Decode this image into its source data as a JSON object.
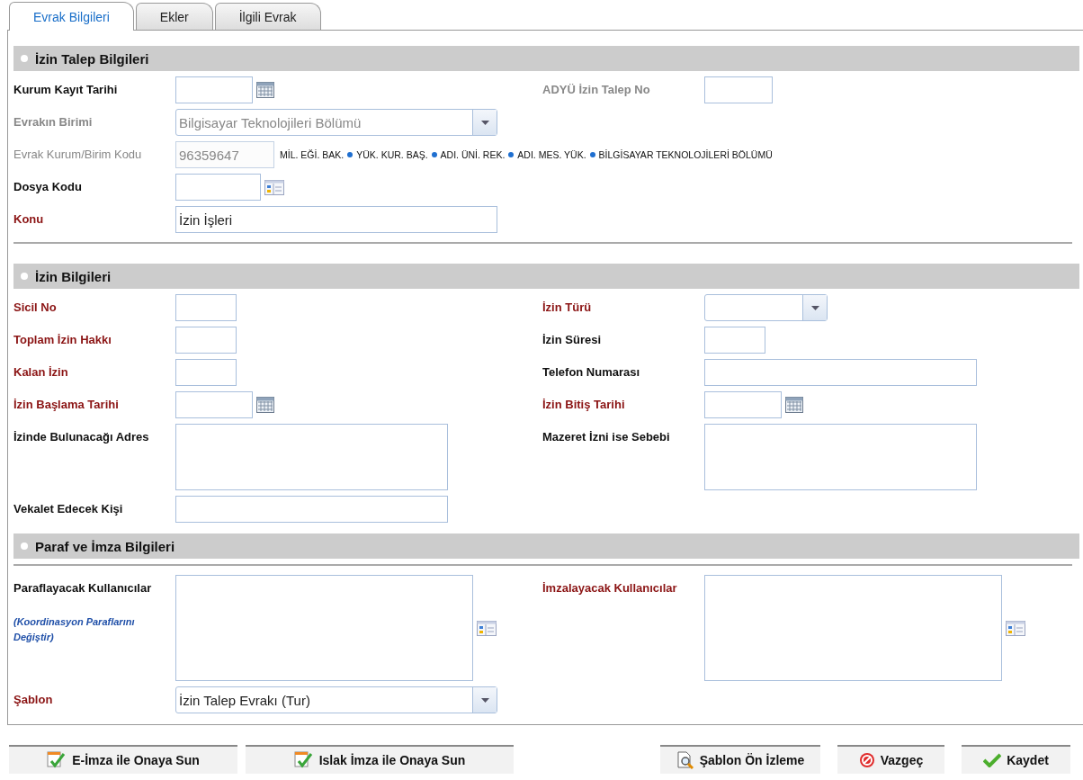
{
  "tabs": [
    {
      "label": "Evrak Bilgileri",
      "selected": true
    },
    {
      "label": "Ekler",
      "selected": false
    },
    {
      "label": "İlgili Evrak",
      "selected": false
    }
  ],
  "sections": [
    {
      "title": "İzin Talep Bilgileri",
      "rule_before_rows": false,
      "rule_after_rows": true,
      "rows": [
        {
          "left": {
            "label": "Kurum Kayıt Tarihi",
            "required": false,
            "muted": false,
            "bold": true,
            "kind": "date",
            "disabled": false
          },
          "right": {
            "label": "ADYÜ İzin Talep No",
            "required": false,
            "muted": true,
            "bold": true,
            "kind": "number",
            "disabled": false
          }
        },
        {
          "left": {
            "label": "Evrakın Birimi",
            "required": false,
            "muted": true,
            "bold": true,
            "kind": "select",
            "disabled": true,
            "value": "Bilgisayar Teknolojileri Bölümü"
          }
        },
        {
          "left": {
            "label": "Evrak Kurum/Birim Kodu",
            "required": false,
            "muted": true,
            "bold": false,
            "kind": "code",
            "disabled": true,
            "value": "96359647",
            "path": [
              "MİL. EĞİ. BAK.",
              "YÜK. KUR. BAŞ.",
              "ADI. ÜNİ. REK.",
              "ADI. MES. YÜK.",
              "BİLGİSAYAR TEKNOLOJİLERİ BÖLÜMÜ"
            ]
          }
        },
        {
          "left": {
            "label": "Dosya Kodu",
            "required": false,
            "muted": false,
            "bold": true,
            "kind": "lookup",
            "disabled": false
          }
        },
        {
          "left": {
            "label": "Konu",
            "required": true,
            "muted": false,
            "bold": true,
            "kind": "long-text",
            "disabled": false,
            "value": "İzin İşleri"
          }
        }
      ]
    },
    {
      "title": "İzin Bilgileri",
      "rule_before_rows": false,
      "rule_after_rows": false,
      "rows": [
        {
          "left": {
            "label": "Sicil No",
            "required": true,
            "muted": false,
            "bold": true,
            "kind": "short",
            "disabled": false
          },
          "right": {
            "label": "İzin Türü",
            "required": true,
            "muted": false,
            "bold": true,
            "kind": "small-select",
            "disabled": false
          }
        },
        {
          "left": {
            "label": "Toplam İzin Hakkı",
            "required": true,
            "muted": false,
            "bold": true,
            "kind": "short",
            "disabled": false
          },
          "right": {
            "label": "İzin Süresi",
            "required": false,
            "muted": false,
            "bold": true,
            "kind": "short",
            "disabled": false
          }
        },
        {
          "left": {
            "label": "Kalan İzin",
            "required": true,
            "muted": false,
            "bold": true,
            "kind": "short",
            "disabled": false
          },
          "right": {
            "label": "Telefon Numarası",
            "required": false,
            "muted": false,
            "bold": true,
            "kind": "text",
            "disabled": false
          }
        },
        {
          "left": {
            "label": "İzin Başlama Tarihi",
            "required": true,
            "muted": false,
            "bold": true,
            "kind": "date",
            "disabled": false
          },
          "right": {
            "label": "İzin Bitiş Tarihi",
            "required": true,
            "muted": false,
            "bold": true,
            "kind": "date",
            "disabled": false
          }
        },
        {
          "left": {
            "label": "İzinde Bulunacağı Adres",
            "required": false,
            "muted": false,
            "bold": true,
            "kind": "textarea",
            "disabled": false
          },
          "right": {
            "label": "Mazeret İzni ise Sebebi",
            "required": false,
            "muted": false,
            "bold": true,
            "kind": "textarea",
            "disabled": false
          }
        },
        {
          "left": {
            "label": "Vekalet Edecek Kişi",
            "required": false,
            "muted": false,
            "bold": true,
            "kind": "text",
            "disabled": false
          }
        }
      ]
    },
    {
      "title": "Paraf ve İmza Bilgileri",
      "rule_before_rows": true,
      "rule_after_rows": false,
      "rows": [
        {
          "left": {
            "label": "Paraflayacak Kullanıcılar",
            "required": false,
            "muted": false,
            "bold": true,
            "kind": "userlist",
            "disabled": false,
            "link": "(Koordinasyon Paraflarını Değiştir)"
          },
          "right": {
            "label": "İmzalayacak Kullanıcılar",
            "required": true,
            "muted": false,
            "bold": true,
            "kind": "userlist",
            "disabled": false
          }
        },
        {
          "left": {
            "label": "Şablon",
            "required": true,
            "muted": false,
            "bold": true,
            "kind": "select",
            "disabled": false,
            "value": "İzin Talep Evrakı (Tur)"
          }
        }
      ]
    }
  ],
  "buttons_left": [
    {
      "label": "E-İmza ile Onaya Sun",
      "kind": "sign"
    },
    {
      "label": "Islak İmza ile Onaya Sun",
      "kind": "sign"
    }
  ],
  "buttons_right": [
    {
      "label": "Şablon Ön İzleme",
      "kind": "preview"
    },
    {
      "label": "Vazgeç",
      "kind": "cancel"
    },
    {
      "label": "Kaydet",
      "kind": "save"
    }
  ]
}
